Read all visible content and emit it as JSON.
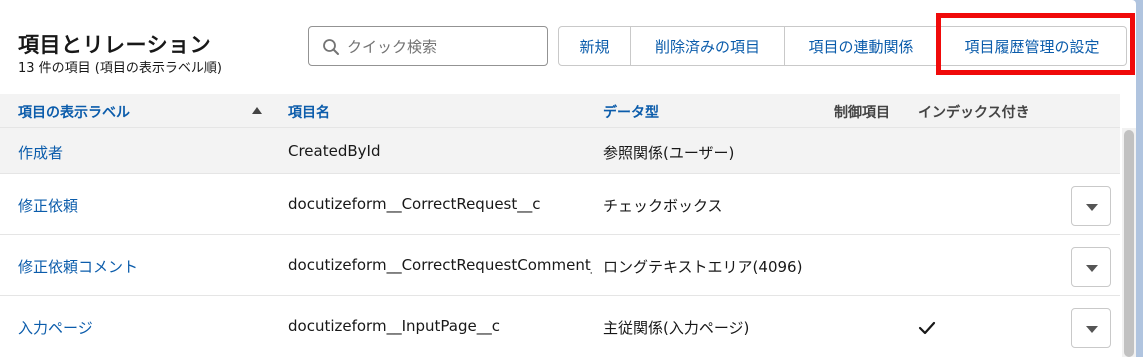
{
  "header": {
    "title": "項目とリレーション",
    "subtitle": "13 件の項目 (項目の表示ラベル順)"
  },
  "search": {
    "placeholder": "クイック検索",
    "value": ""
  },
  "buttons": {
    "new": "新規",
    "deleted": "削除済みの項目",
    "dependencies": "項目の連動関係",
    "history": "項目履歴管理の設定"
  },
  "table": {
    "columns": {
      "label": "項目の表示ラベル",
      "api": "項目名",
      "type": "データ型",
      "controlling": "制御項目",
      "indexed": "インデックス付き"
    },
    "rows": [
      {
        "label": "作成者",
        "api": "CreatedById",
        "type": "参照関係(ユーザー)",
        "indexed": false
      },
      {
        "label": "修正依頼",
        "api": "docutizeform__CorrectRequest__c",
        "type": "チェックボックス",
        "indexed": false
      },
      {
        "label": "修正依頼コメント",
        "api": "docutizeform__CorrectRequestComment__c",
        "type": "ロングテキストエリア(4096)",
        "indexed": false
      },
      {
        "label": "入力ページ",
        "api": "docutizeform__InputPage__c",
        "type": "主従関係(入力ページ)",
        "indexed": true
      }
    ]
  },
  "colors": {
    "accent": "#0b5cab",
    "highlight": "#f00a0a",
    "header_bg": "#f3f3f3"
  },
  "icons": {
    "search": "search-icon",
    "sort": "sort-ascending-icon",
    "check": "checkmark-icon",
    "dropdown": "chevron-down-icon"
  }
}
